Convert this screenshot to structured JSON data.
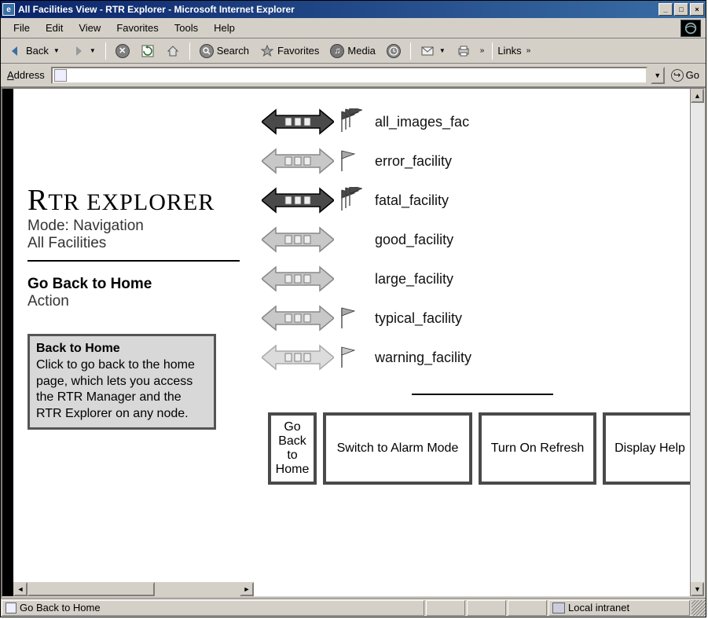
{
  "window": {
    "title": "All Facilities View - RTR Explorer - Microsoft Internet Explorer"
  },
  "menu": {
    "file": "File",
    "edit": "Edit",
    "view": "View",
    "favorites": "Favorites",
    "tools": "Tools",
    "help": "Help"
  },
  "toolbar": {
    "back": "Back",
    "search": "Search",
    "favorites": "Favorites",
    "media": "Media",
    "links": "Links"
  },
  "address": {
    "label": "Address",
    "value": "",
    "go": "Go"
  },
  "explorer": {
    "title_prefix": "R",
    "title_rest": "TR EXPLORER",
    "mode_label": "Mode: Navigation",
    "scope_label": "All Facilities",
    "action_title": "Go Back to Home",
    "action_sub": "Action",
    "help_title": "Back to Home",
    "help_text": "Click to go back to the home page, which lets you access the RTR Manager and the RTR Explorer on any node."
  },
  "facilities": [
    {
      "name": "all_images_fac",
      "arrow_fill": "#4a4a4a",
      "arrow_stroke": "#000",
      "flag_fill": "#4a4a4a",
      "flag_count": 3
    },
    {
      "name": "error_facility",
      "arrow_fill": "#c8c8c8",
      "arrow_stroke": "#888",
      "flag_fill": "#a8a8a8",
      "flag_count": 1
    },
    {
      "name": "fatal_facility",
      "arrow_fill": "#4a4a4a",
      "arrow_stroke": "#000",
      "flag_fill": "#4a4a4a",
      "flag_count": 3
    },
    {
      "name": "good_facility",
      "arrow_fill": "#c8c8c8",
      "arrow_stroke": "#888",
      "flag_fill": "none",
      "flag_count": 0
    },
    {
      "name": "large_facility",
      "arrow_fill": "#c8c8c8",
      "arrow_stroke": "#888",
      "flag_fill": "none",
      "flag_count": 0
    },
    {
      "name": "typical_facility",
      "arrow_fill": "#c8c8c8",
      "arrow_stroke": "#888",
      "flag_fill": "#a8a8a8",
      "flag_count": 1
    },
    {
      "name": "warning_facility",
      "arrow_fill": "#dcdcdc",
      "arrow_stroke": "#aaa",
      "flag_fill": "#c8c8c8",
      "flag_count": 1
    }
  ],
  "buttons": {
    "back_home": "Go Back to Home",
    "alarm": "Switch to Alarm Mode",
    "refresh": "Turn On Refresh",
    "help": "Display Help"
  },
  "status": {
    "text": "Go Back to Home",
    "zone": "Local intranet"
  }
}
